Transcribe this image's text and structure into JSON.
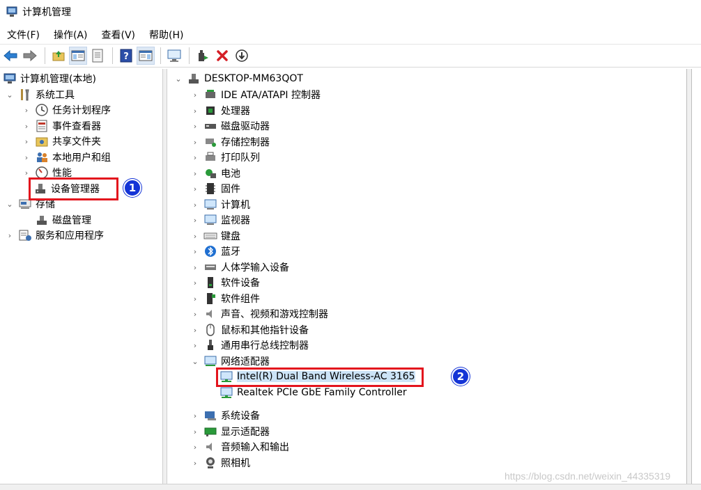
{
  "window": {
    "title": "计算机管理"
  },
  "menu": [
    "文件(F)",
    "操作(A)",
    "查看(V)",
    "帮助(H)"
  ],
  "toolbar": [
    "back-arrow-icon",
    "forward-arrow-icon",
    "up-folder-icon",
    "show-hide-tree-icon",
    "properties-icon",
    "help-icon",
    "view-icon",
    "monitor-icon",
    "update-driver-icon",
    "uninstall-icon",
    "disable-icon"
  ],
  "left_tree": {
    "root": "计算机管理(本地)",
    "system_tools": "系统工具",
    "task_scheduler": "任务计划程序",
    "event_viewer": "事件查看器",
    "shared_folders": "共享文件夹",
    "local_users": "本地用户和组",
    "performance": "性能",
    "device_manager": "设备管理器",
    "storage": "存储",
    "disk_management": "磁盘管理",
    "services_apps": "服务和应用程序"
  },
  "device_tree": {
    "computer": "DESKTOP-MM63QOT",
    "categories": [
      "IDE ATA/ATAPI 控制器",
      "处理器",
      "磁盘驱动器",
      "存储控制器",
      "打印队列",
      "电池",
      "固件",
      "计算机",
      "监视器",
      "键盘",
      "蓝牙",
      "人体学输入设备",
      "软件设备",
      "软件组件",
      "声音、视频和游戏控制器",
      "鼠标和其他指针设备",
      "通用串行总线控制器",
      "网络适配器"
    ],
    "network_adapters": [
      "Intel(R) Dual Band Wireless-AC 3165",
      "Realtek PCIe GbE Family Controller"
    ],
    "more_categories": [
      "系统设备",
      "显示适配器",
      "音频输入和输出",
      "照相机"
    ]
  },
  "annotations": {
    "badge1": "1",
    "badge2": "2"
  },
  "watermark": "https://blog.csdn.net/weixin_44335319"
}
